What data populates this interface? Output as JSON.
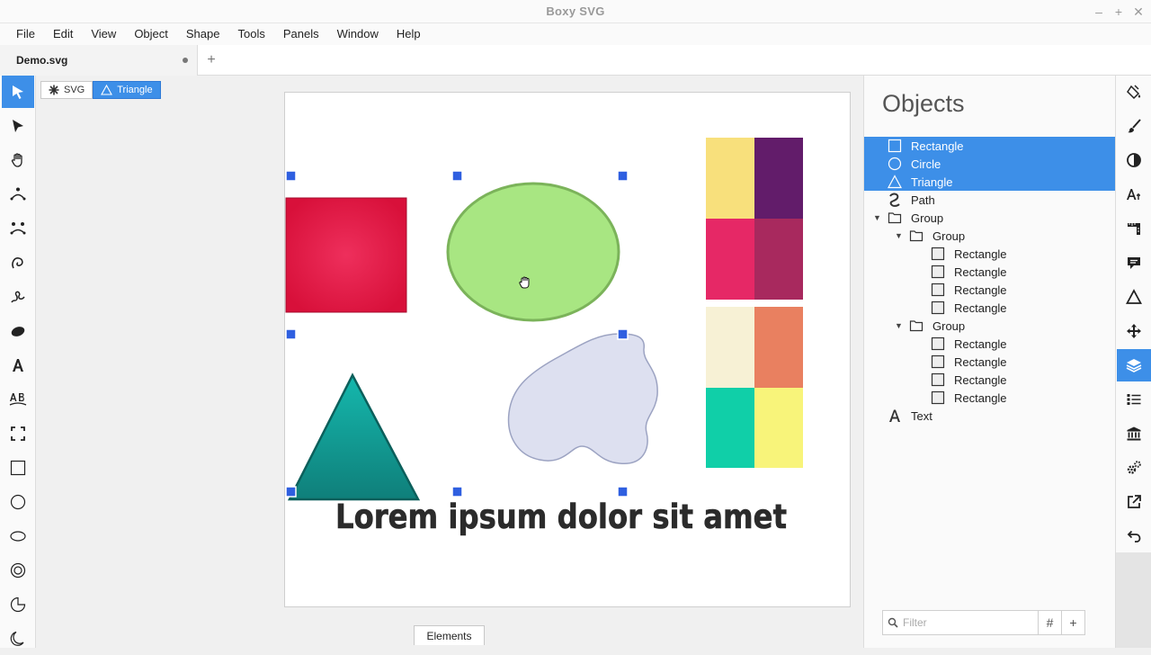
{
  "app": {
    "title": "Boxy SVG"
  },
  "window_controls": {
    "minimize": "–",
    "maximize": "+",
    "close": "✕"
  },
  "menu": [
    "File",
    "Edit",
    "View",
    "Object",
    "Shape",
    "Tools",
    "Panels",
    "Window",
    "Help"
  ],
  "tabs": {
    "document": "Demo.svg",
    "new_tab": "+"
  },
  "breadcrumbs": [
    {
      "label": "SVG",
      "icon": "asterisk-icon"
    },
    {
      "label": "Triangle",
      "icon": "triangle-icon"
    }
  ],
  "canvas": {
    "text": "Lorem ipsum dolor sit amet",
    "colors": {
      "rectangle": "#e01a44",
      "circle_fill": "#a8e682",
      "circle_stroke": "#7bb35a",
      "path_fill": "#dde0f0",
      "triangle_top": "#15b8ad",
      "triangle_bottom": "#0e7f7a",
      "handles": "#2f5fe0"
    },
    "swatches_top": [
      "#f8e07c",
      "#621c6a",
      "#e62866",
      "#a8295e"
    ],
    "swatches_bottom": [
      "#f7f1d5",
      "#e98060",
      "#10cfa8",
      "#f8f47a"
    ]
  },
  "footer": {
    "elements_button": "Elements"
  },
  "panel": {
    "title": "Objects",
    "items": [
      {
        "label": "Rectangle",
        "icon": "square-icon",
        "depth": 0,
        "selected": true
      },
      {
        "label": "Circle",
        "icon": "circle-icon",
        "depth": 0,
        "selected": true
      },
      {
        "label": "Triangle",
        "icon": "triangle-icon",
        "depth": 0,
        "selected": true
      },
      {
        "label": "Path",
        "icon": "path-icon",
        "depth": 0,
        "selected": false
      },
      {
        "label": "Group",
        "icon": "folder-icon",
        "depth": 0,
        "expanded": true,
        "selected": false
      },
      {
        "label": "Group",
        "icon": "folder-icon",
        "depth": 1,
        "expanded": true,
        "selected": false
      },
      {
        "label": "Rectangle",
        "icon": "square-icon",
        "depth": 2,
        "selected": false
      },
      {
        "label": "Rectangle",
        "icon": "square-icon",
        "depth": 2,
        "selected": false
      },
      {
        "label": "Rectangle",
        "icon": "square-icon",
        "depth": 2,
        "selected": false
      },
      {
        "label": "Rectangle",
        "icon": "square-icon",
        "depth": 2,
        "selected": false
      },
      {
        "label": "Group",
        "icon": "folder-icon",
        "depth": 1,
        "expanded": true,
        "selected": false
      },
      {
        "label": "Rectangle",
        "icon": "square-icon",
        "depth": 2,
        "selected": false
      },
      {
        "label": "Rectangle",
        "icon": "square-icon",
        "depth": 2,
        "selected": false
      },
      {
        "label": "Rectangle",
        "icon": "square-icon",
        "depth": 2,
        "selected": false
      },
      {
        "label": "Rectangle",
        "icon": "square-icon",
        "depth": 2,
        "selected": false
      },
      {
        "label": "Text",
        "icon": "text-icon",
        "depth": 0,
        "selected": false
      }
    ],
    "filter_placeholder": "Filter",
    "hash_button": "#",
    "add_button": "+"
  },
  "accent_color": "#3d8fe8"
}
